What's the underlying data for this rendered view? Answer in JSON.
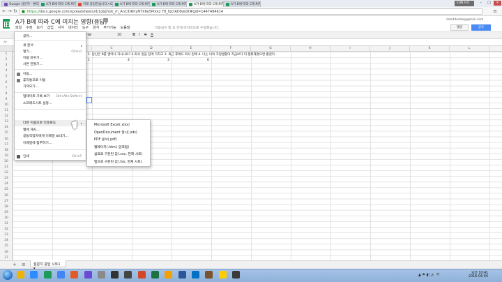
{
  "browser": {
    "tabs": [
      {
        "label": "Google 설문지 - 온라인",
        "color": "#7349b2"
      },
      {
        "label": "A가 B에 따라 C에 미치는",
        "color": "#1e9b57"
      },
      {
        "label": "미래 종업한습니다 - G",
        "color": "#db4437"
      },
      {
        "label": "A가 B에 따라 C에 미치는",
        "color": "#1e9b57"
      },
      {
        "label": "A가 B에 따라 C에 미치는",
        "color": "#1e9b57"
      },
      {
        "label": "A가 B에 따라 C에 미치는",
        "color": "#1e9b57"
      },
      {
        "label": "A가 B에 따라 C에 미치는",
        "color": "#1e9b57"
      }
    ],
    "tab_close": "×",
    "profile": "EUN HO",
    "win_min": "–",
    "win_max": "□",
    "win_close": "×",
    "url_scheme": "https://",
    "url_rest": "docs.google.com/spreadsheets/d/1qGJhUk_m_AnCIDRhyNTX6e5Ptkkz Y8_fqctAD9/edit#gid=1447494614",
    "back": "←",
    "forward": "→",
    "reload": "↻",
    "menu": "≡"
  },
  "doc": {
    "title": "A가 B에 따라 C에 미치는 영향(응답)",
    "star": "☆",
    "account": "ddoddoddo@gmail.com",
    "comments_label": "댓글",
    "share_label": "공유",
    "saved_note": "작동님이 몇 초 전에 마지막으로 수정했습니다.",
    "menus": [
      "파일",
      "수정",
      "보기",
      "삽입",
      "서식",
      "데이터",
      "도구",
      "양식",
      "부가기능",
      "도움말"
    ]
  },
  "toolbar": {
    "font": "Arial",
    "font_size": "10",
    "bold": "B",
    "italic": "I",
    "strike": "S",
    "text_color": "A",
    "fx": "fx"
  },
  "grid": {
    "columns": [
      "A",
      "B",
      "C",
      "D",
      "E",
      "F",
      "G",
      "H",
      "I",
      "J",
      "K",
      "L"
    ],
    "rows": [
      "1",
      "2",
      "3",
      "4",
      "5",
      "6",
      "7",
      "8",
      "9",
      "10",
      "11",
      "12",
      "13",
      "14",
      "15",
      "16",
      "17",
      "18",
      "19",
      "20",
      "21",
      "22",
      "23",
      "24",
      "25",
      "26",
      "27",
      "28",
      "29",
      "30",
      "31",
      "32",
      "33",
      "34",
      "35",
      "36",
      "37"
    ],
    "header_text": "1. 당신은 B를 얼마나 하시나요? 2.회사 일을 집에 가지고 3. 퇴근 후에도 회사 일에 4. 나는 나의 가정생활이 지금보다 더 행복해졌으면 좋겠다.",
    "row2_values": [
      "1",
      "4",
      "3",
      "6"
    ]
  },
  "file_menu": {
    "items": [
      {
        "label": "공유...",
        "shortcut": ""
      },
      {
        "label": "새 문서",
        "shortcut": "",
        "submenu": true
      },
      {
        "label": "열기...",
        "shortcut": "Ctrl+O"
      },
      {
        "label": "이름 바꾸기...",
        "shortcut": ""
      },
      {
        "label": "사본 만들기...",
        "shortcut": ""
      },
      {
        "label": "이동...",
        "shortcut": ""
      },
      {
        "label": "휴지통으로 이동",
        "shortcut": ""
      },
      {
        "label": "가져오기...",
        "shortcut": ""
      },
      {
        "label": "업데이트 기록 보기",
        "shortcut": "Ctrl+Alt+Shift+H"
      },
      {
        "label": "스프레드시트 설정...",
        "shortcut": ""
      },
      {
        "label": "다른 이름으로 다운로드",
        "shortcut": "",
        "submenu": true
      },
      {
        "label": "웹에 게시...",
        "shortcut": ""
      },
      {
        "label": "공동작업자에게 이메일 보내기...",
        "shortcut": ""
      },
      {
        "label": "이메일에 첨부하기...",
        "shortcut": ""
      },
      {
        "label": "인쇄",
        "shortcut": "Ctrl+P"
      }
    ],
    "arrow": "▸"
  },
  "download_submenu": {
    "items": [
      "Microsoft Excel(.xlsx)",
      "OpenDocument 형식(.ods)",
      "PDF 문서(.pdf)",
      "웹페이지(.html, 압축됨)",
      "쉼표로 구분된 값(.csv, 현재 시트)",
      "탭으로 구분된 값(.tsv, 현재 시트)"
    ]
  },
  "sheets": {
    "add": "+",
    "list": "≡",
    "active": "설문지 응답 시트1 ▾"
  },
  "taskbar": {
    "time": "오전 10:41",
    "date": "2016-04-04",
    "sys": "▲ ⚑ ◧ 🔊 가",
    "apps": [
      "#f0b400",
      "#2d8cff",
      "#1e9b57",
      "#4285f4",
      "#e05a2a",
      "#6b4ad6",
      "#8a8a8a",
      "#333333",
      "#444444",
      "#d24726",
      "#1e7145",
      "#f2a100",
      "#2b579a",
      "#0072c6",
      "#7a5230",
      "#ffcc00",
      "#3a3a3a"
    ]
  }
}
